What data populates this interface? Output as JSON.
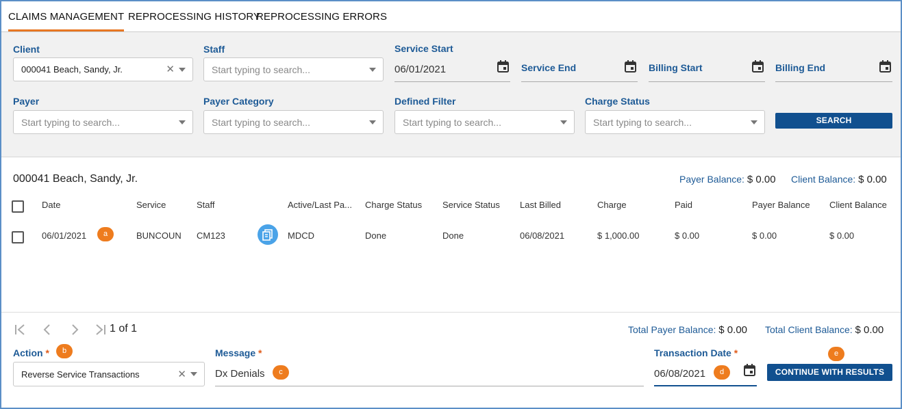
{
  "tabs": [
    {
      "label": "CLAIMS MANAGEMENT",
      "active": true
    },
    {
      "label": "REPROCESSING HISTORY",
      "active": false
    },
    {
      "label": "REPROCESSING ERRORS",
      "active": false
    }
  ],
  "filters": {
    "client": {
      "label": "Client",
      "value": "000041 Beach, Sandy, Jr."
    },
    "staff": {
      "label": "Staff",
      "placeholder": "Start typing to search..."
    },
    "service_start": {
      "label": "Service Start",
      "value": "06/01/2021"
    },
    "service_end": {
      "label": "Service End"
    },
    "billing_start": {
      "label": "Billing Start"
    },
    "billing_end": {
      "label": "Billing End"
    },
    "payer": {
      "label": "Payer",
      "placeholder": "Start typing to search..."
    },
    "payer_category": {
      "label": "Payer Category",
      "placeholder": "Start typing to search..."
    },
    "defined_filter": {
      "label": "Defined Filter",
      "placeholder": "Start typing to search..."
    },
    "charge_status": {
      "label": "Charge Status",
      "placeholder": "Start typing to search..."
    },
    "search_label": "SEARCH"
  },
  "results": {
    "client_heading": "000041 Beach, Sandy, Jr.",
    "payer_balance_label": "Payer Balance:",
    "payer_balance": "$ 0.00",
    "client_balance_label": "Client Balance:",
    "client_balance": "$ 0.00",
    "columns": [
      "Date",
      "Service",
      "Staff",
      "Active/Last Pa...",
      "Charge Status",
      "Service Status",
      "Last Billed",
      "Charge",
      "Paid",
      "Payer Balance",
      "Client Balance"
    ],
    "rows": [
      {
        "date": "06/01/2021",
        "service": "BUNCOUN",
        "staff": "CM123",
        "active_last_payer": "MDCD",
        "charge_status": "Done",
        "service_status": "Done",
        "last_billed": "06/08/2021",
        "charge": "$ 1,000.00",
        "paid": "$ 0.00",
        "payer_balance": "$ 0.00",
        "client_balance": "$ 0.00"
      }
    ]
  },
  "pager": {
    "text": "1 of 1"
  },
  "totals": {
    "payer_label": "Total Payer Balance:",
    "payer_value": "$ 0.00",
    "client_label": "Total Client Balance:",
    "client_value": "$ 0.00"
  },
  "action_bar": {
    "action_label": "Action",
    "action_value": "Reverse Service Transactions",
    "message_label": "Message",
    "message_value": "Dx Denials",
    "transaction_date_label": "Transaction Date",
    "transaction_date_value": "06/08/2021",
    "required_mark": "*",
    "continue_label": "CONTINUE WITH RESULTS"
  },
  "annotations": {
    "a": "a",
    "b": "b",
    "c": "c",
    "d": "d",
    "e": "e"
  },
  "colors": {
    "accent": "#e87722",
    "brand": "#11508f",
    "label": "#1d5a96",
    "badge": "#ee7c1e"
  }
}
